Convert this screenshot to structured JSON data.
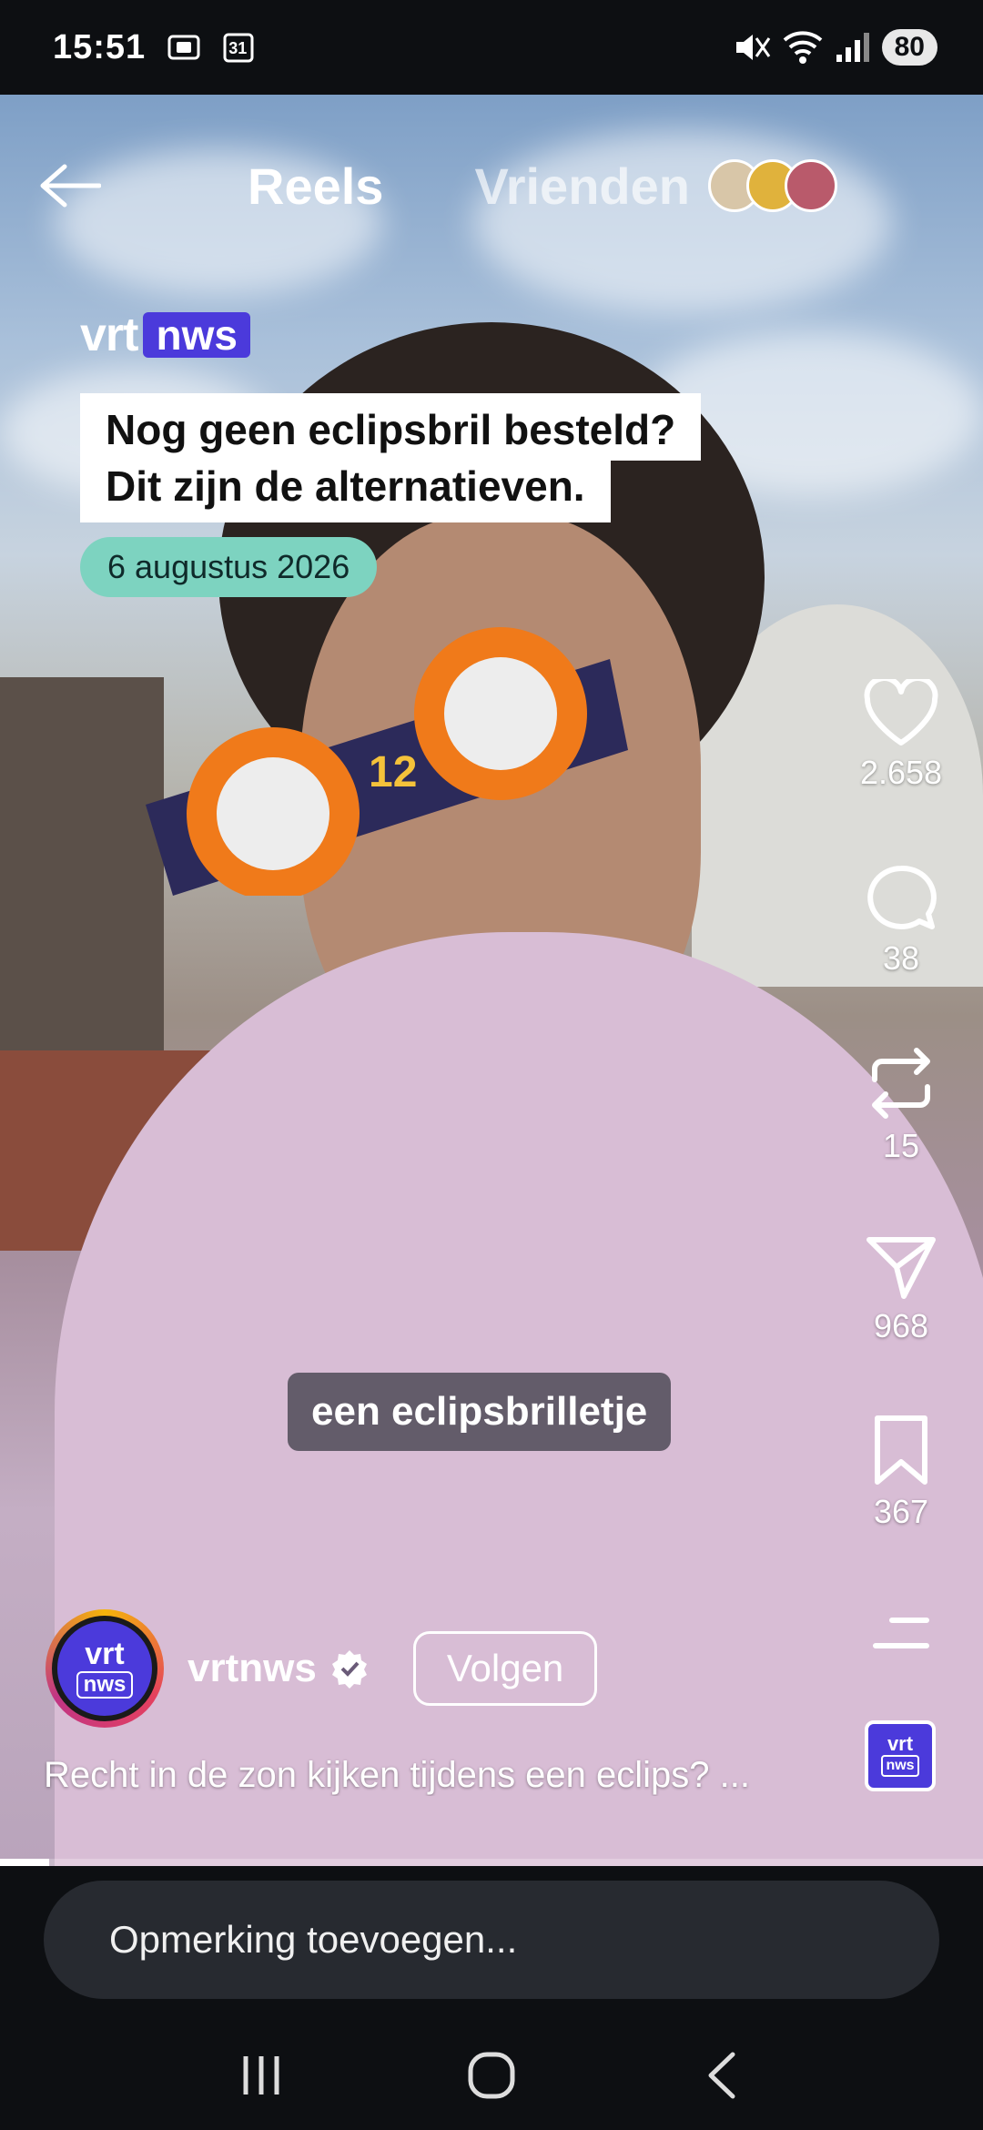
{
  "status_bar": {
    "time": "15:51",
    "calendar_day": "31",
    "battery": "80",
    "icons": [
      "screenshot-icon",
      "calendar-icon",
      "mute-icon",
      "wifi-icon",
      "signal-icon"
    ]
  },
  "top_nav": {
    "back_icon": "arrow-left-icon",
    "tabs": [
      {
        "label": "Reels",
        "active": true
      },
      {
        "label": "Vrienden",
        "active": false
      }
    ]
  },
  "video": {
    "brand": {
      "vrt": "vrt",
      "nws": "nws"
    },
    "headline_lines": [
      "Nog geen eclipsbril besteld?",
      "Dit zijn de alternatieven."
    ],
    "date": "6 augustus 2026",
    "caption_chip": "een eclipsbrilletje",
    "glasses_text": "12"
  },
  "actions": {
    "like": {
      "icon": "heart-icon",
      "count": "2.658"
    },
    "comment": {
      "icon": "comment-icon",
      "count": "38"
    },
    "repost": {
      "icon": "repost-icon",
      "count": "15"
    },
    "share": {
      "icon": "send-icon",
      "count": "968"
    },
    "save": {
      "icon": "bookmark-icon",
      "count": "367"
    },
    "more": {
      "icon": "menu-icon"
    }
  },
  "author": {
    "avatar_top": "vrt",
    "avatar_bottom": "nws",
    "username": "vrtnws",
    "verified": true,
    "follow_label": "Volgen",
    "caption": "Recht in de zon kijken tijdens een eclips? ..."
  },
  "audio_thumb": {
    "top": "vrt",
    "bottom": "nws"
  },
  "playback": {
    "progress": 0.05
  },
  "comment_bar": {
    "placeholder": "Opmerking toevoegen..."
  },
  "system_nav": {
    "icons": [
      "recents-icon",
      "home-icon",
      "back-icon"
    ]
  },
  "colors": {
    "brand_purple": "#4b3adb",
    "date_pill": "#7dd3c0",
    "comment_bg": "#272a30"
  }
}
